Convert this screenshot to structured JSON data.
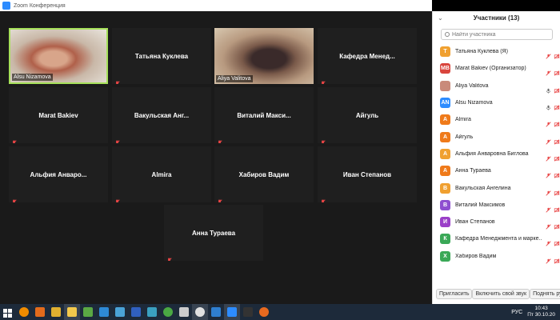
{
  "window": {
    "title": "Zoom Конференция"
  },
  "stage": {
    "tiles": [
      {
        "name": "Alsu Nizamova",
        "type": "video",
        "active": true
      },
      {
        "name": "Татьяна  Куклева",
        "type": "name"
      },
      {
        "name": "Aliya  Valitova",
        "type": "video"
      },
      {
        "name": "Кафедра  Менед...",
        "type": "name"
      },
      {
        "name": "Marat Bakiev",
        "type": "name"
      },
      {
        "name": "Вакульская  Анг...",
        "type": "name"
      },
      {
        "name": "Виталий  Макси...",
        "type": "name"
      },
      {
        "name": "Айгуль",
        "type": "name"
      },
      {
        "name": "Альфия  Анваро...",
        "type": "name"
      },
      {
        "name": "Almira",
        "type": "name"
      },
      {
        "name": "Хабиров Вадим",
        "type": "name"
      },
      {
        "name": "Иван Степанов",
        "type": "name"
      },
      {
        "name": "Анна Тураева",
        "type": "name"
      }
    ]
  },
  "panel": {
    "title": "Участники (13)",
    "search_placeholder": "Найти участника",
    "participants": [
      {
        "initials": "Т",
        "name": "Татьяна Куклева (Я)",
        "color": "#f0a030"
      },
      {
        "initials": "MB",
        "name": "Marat Bakiev (Организатор)",
        "color": "#d9453d"
      },
      {
        "initials": "",
        "name": "Aliya Valitova",
        "color": "#c98a7a"
      },
      {
        "initials": "AN",
        "name": "Alsu Nizamova",
        "color": "#2d8cff"
      },
      {
        "initials": "A",
        "name": "Almira",
        "color": "#ef7a1a"
      },
      {
        "initials": "A",
        "name": "Айгуль",
        "color": "#ef7a1a"
      },
      {
        "initials": "A",
        "name": "Альфия Анваровна Биглова",
        "color": "#f0a030"
      },
      {
        "initials": "A",
        "name": "Анна Тураева",
        "color": "#ef7a1a"
      },
      {
        "initials": "В",
        "name": "Вакульская Ангелина",
        "color": "#f0a030"
      },
      {
        "initials": "В",
        "name": "Виталий Максимов",
        "color": "#8e4fd0"
      },
      {
        "initials": "И",
        "name": "Иван Степанов",
        "color": "#9a3fc8"
      },
      {
        "initials": "К",
        "name": "Кафедра Менеджмента и марке...",
        "color": "#3aa857"
      },
      {
        "initials": "Х",
        "name": "Хабиров Вадим",
        "color": "#3aa857"
      }
    ],
    "buttons": {
      "invite": "Пригласить",
      "unmute": "Включить свой звук",
      "raise": "Поднять руку"
    }
  },
  "taskbar": {
    "lang": "РУС",
    "time": "10:43",
    "date": "Пт 30.10.20",
    "apps": [
      {
        "icon": "windows-start-icon",
        "color": "#ffffff"
      },
      {
        "icon": "vlc-icon",
        "color": "#f08c00"
      },
      {
        "icon": "app-orange-icon",
        "color": "#e36b1c"
      },
      {
        "icon": "app-yellow-icon",
        "color": "#e0b030"
      },
      {
        "icon": "file-explorer-icon",
        "color": "#f2c94c"
      },
      {
        "icon": "app-green-icon",
        "color": "#5aa844"
      },
      {
        "icon": "app-blue-icon",
        "color": "#2e8ad6"
      },
      {
        "icon": "screen-icon",
        "color": "#4aa3d8"
      },
      {
        "icon": "app-blue2-icon",
        "color": "#3060c0"
      },
      {
        "icon": "app-teal-icon",
        "color": "#3aa0c0"
      },
      {
        "icon": "utorrent-icon",
        "color": "#4aa843"
      },
      {
        "icon": "app-white-icon",
        "color": "#cccccc"
      },
      {
        "icon": "chrome-icon",
        "color": "#e0e0e0"
      },
      {
        "icon": "app-blue3-icon",
        "color": "#2f7fd0"
      },
      {
        "icon": "zoom-icon",
        "color": "#2d8cff"
      },
      {
        "icon": "app-dark-icon",
        "color": "#333333"
      },
      {
        "icon": "firefox-icon",
        "color": "#e86a1f"
      }
    ]
  }
}
